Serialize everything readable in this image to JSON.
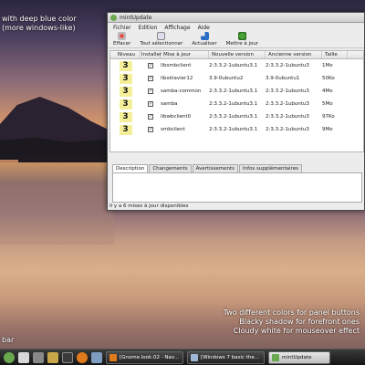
{
  "desktop": {
    "caption_top": [
      "with deep blue color",
      "(more windows-like)"
    ],
    "caption_bottom": [
      "Two different colors for panel buttons",
      "Blacky shadow for forefront ones",
      "Cloudy white for mouseover effect"
    ],
    "caption_bar": "bar"
  },
  "window": {
    "title": "mintUpdate",
    "menu": [
      "Fichier",
      "Edition",
      "Affichage",
      "Aide"
    ],
    "toolbar": [
      "Effacer",
      "Tout sélectionner",
      "Actualiser",
      "Mettre à jour"
    ],
    "columns": [
      "Niveau",
      "Installer",
      "Mise à jour",
      "Nouvelle version",
      "Ancienne version",
      "Taille"
    ],
    "rows": [
      {
        "level": "3",
        "installed": true,
        "package": "libsmbclient",
        "current": "2:3.3.2-1ubuntu3.1",
        "new": "2:3.3.2-1ubuntu3",
        "size": "1Mo"
      },
      {
        "level": "3",
        "installed": true,
        "package": "libxklavier12",
        "current": "3.9-0ubuntu2",
        "new": "3.9-0ubuntu1",
        "size": "50Ko"
      },
      {
        "level": "3",
        "installed": true,
        "package": "samba-common",
        "current": "2:3.3.2-1ubuntu3.1",
        "new": "2:3.3.2-1ubuntu3",
        "size": "4Mo"
      },
      {
        "level": "3",
        "installed": true,
        "package": "samba",
        "current": "2:3.3.2-1ubuntu3.1",
        "new": "2:3.3.2-1ubuntu3",
        "size": "5Mo"
      },
      {
        "level": "3",
        "installed": true,
        "package": "libwbclient0",
        "current": "2:3.3.2-1ubuntu3.1",
        "new": "2:3.3.2-1ubuntu3",
        "size": "97Ko"
      },
      {
        "level": "3",
        "installed": true,
        "package": "smbclient",
        "current": "2:3.3.2-1ubuntu3.1",
        "new": "2:3.3.2-1ubuntu3",
        "size": "9Mo"
      }
    ],
    "tabs": [
      "Description",
      "Changements",
      "Avertissements",
      "Infos supplémentaires"
    ],
    "status": "Il y a 6 mises à jour disponibles"
  },
  "taskbar": {
    "buttons": [
      "[Gnome.look.02 - Nav...",
      "[Windows 7 basic the...",
      "mintUpdate"
    ]
  }
}
